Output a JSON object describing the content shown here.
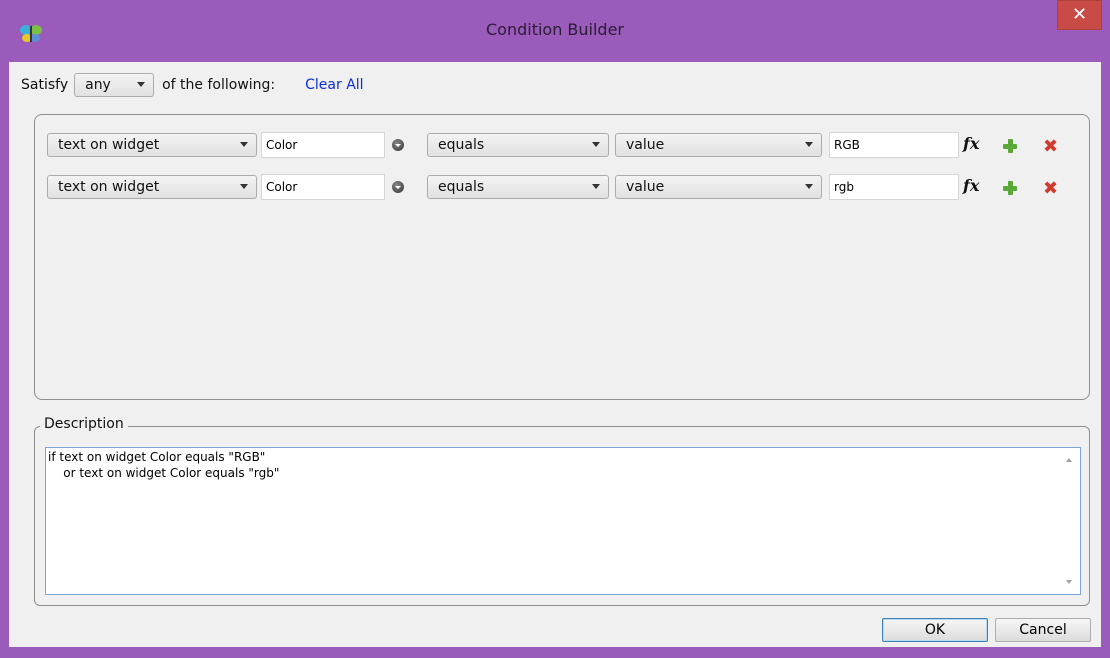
{
  "window": {
    "title": "Condition Builder",
    "close_glyph": "✕",
    "app_icon": "butterfly-app-icon"
  },
  "satisfy": {
    "label": "Satisfy",
    "mode": "any",
    "suffix": "of the following:",
    "clear_all": "Clear All"
  },
  "conditions": [
    {
      "subject": "text on widget",
      "widget": "Color",
      "operator": "equals",
      "value_type": "value",
      "value": "RGB"
    },
    {
      "subject": "text on widget",
      "widget": "Color",
      "operator": "equals",
      "value_type": "value",
      "value": "rgb"
    }
  ],
  "icons": {
    "fx": "fx",
    "add": "add-icon",
    "delete": "✖",
    "widget_picker": "dropdown-circle-icon"
  },
  "description": {
    "legend": "Description",
    "lines": [
      "if text on widget Color equals \"RGB\"",
      "    or text on widget Color equals \"rgb\""
    ]
  },
  "buttons": {
    "ok": "OK",
    "cancel": "Cancel"
  },
  "colors": {
    "titlebar": "#9a5bbb",
    "close": "#c84b45",
    "link": "#0b2ddb",
    "add": "#5aa83a",
    "delete": "#d23a2f"
  }
}
